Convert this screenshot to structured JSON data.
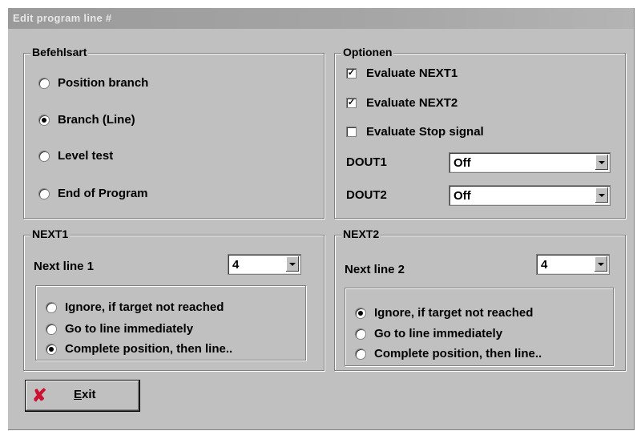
{
  "window": {
    "title": "Edit program line #"
  },
  "befehlsart": {
    "legend": "Befehlsart",
    "options": [
      {
        "label": "Position branch",
        "selected": false
      },
      {
        "label": "Branch (Line)",
        "selected": true
      },
      {
        "label": "Level test",
        "selected": false
      },
      {
        "label": "End of Program",
        "selected": false
      }
    ]
  },
  "optionen": {
    "legend": "Optionen",
    "checks": [
      {
        "label": "Evaluate NEXT1",
        "checked": true
      },
      {
        "label": "Evaluate NEXT2",
        "checked": true
      },
      {
        "label": "Evaluate Stop signal",
        "checked": false
      }
    ],
    "dout1": {
      "label": "DOUT1",
      "value": "Off"
    },
    "dout2": {
      "label": "DOUT2",
      "value": "Off"
    }
  },
  "next1": {
    "legend": "NEXT1",
    "line_label": "Next line 1",
    "line_value": "4",
    "options": [
      {
        "label": "Ignore, if target not reached",
        "selected": false
      },
      {
        "label": "Go to line immediately",
        "selected": false
      },
      {
        "label": "Complete position, then line..",
        "selected": true
      }
    ]
  },
  "next2": {
    "legend": "NEXT2",
    "line_label": "Next line 2",
    "line_value": "4",
    "options": [
      {
        "label": "Ignore, if target not reached",
        "selected": true
      },
      {
        "label": "Go to line immediately",
        "selected": false
      },
      {
        "label": "Complete position, then line..",
        "selected": false
      }
    ]
  },
  "exit_button": {
    "label_underlined": "E",
    "label_rest": "xit",
    "icon": "close-x-icon",
    "icon_color": "#cc1133"
  }
}
